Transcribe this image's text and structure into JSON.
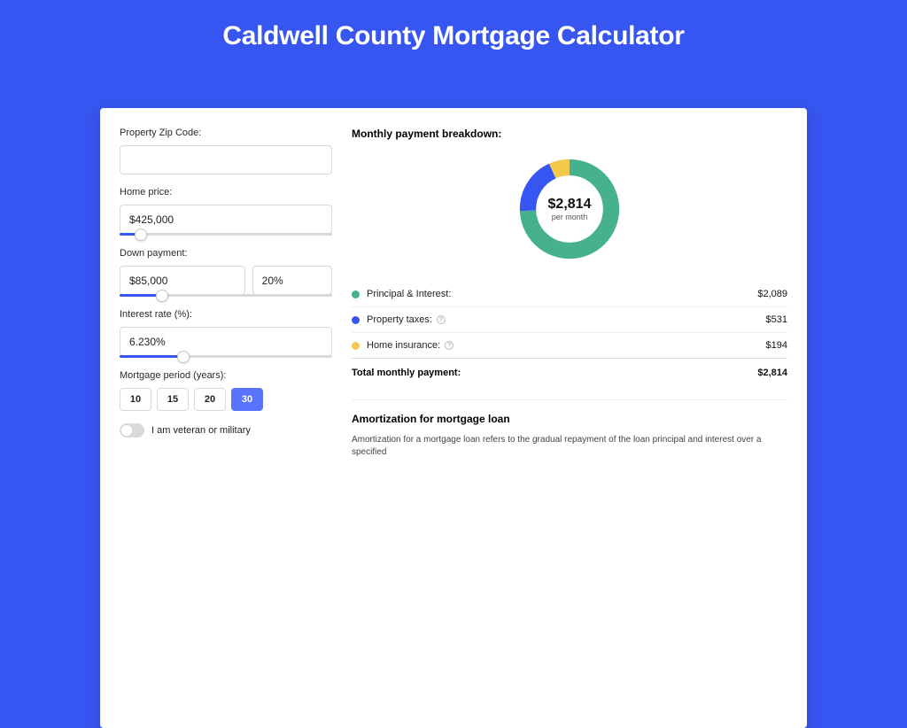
{
  "page": {
    "title": "Caldwell County Mortgage Calculator"
  },
  "inputs": {
    "zip_label": "Property Zip Code:",
    "zip_value": "",
    "home_price_label": "Home price:",
    "home_price_value": "$425,000",
    "home_price_pct": 10,
    "down_label": "Down payment:",
    "down_value": "$85,000",
    "down_pct_value": "20%",
    "down_slider_pct": 20,
    "rate_label": "Interest rate (%):",
    "rate_value": "6.230%",
    "rate_slider_pct": 30,
    "period_label": "Mortgage period (years):",
    "period_options": [
      "10",
      "15",
      "20",
      "30"
    ],
    "period_selected": "30",
    "veteran_label": "I am veteran or military",
    "veteran_on": false
  },
  "breakdown": {
    "title": "Monthly payment breakdown:",
    "donut_value": "$2,814",
    "donut_sub": "per month",
    "items": [
      {
        "label": "Principal & Interest:",
        "value": "$2,089",
        "color": "#45b18e",
        "num": 2089,
        "info": false
      },
      {
        "label": "Property taxes:",
        "value": "$531",
        "color": "#3755f0",
        "num": 531,
        "info": true
      },
      {
        "label": "Home insurance:",
        "value": "$194",
        "color": "#f3c84b",
        "num": 194,
        "info": true
      }
    ],
    "total_label": "Total monthly payment:",
    "total_value": "$2,814"
  },
  "amortization": {
    "title": "Amortization for mortgage loan",
    "text": "Amortization for a mortgage loan refers to the gradual repayment of the loan principal and interest over a specified"
  },
  "chart_data": {
    "type": "pie",
    "title": "Monthly payment breakdown",
    "series": [
      {
        "name": "Principal & Interest",
        "value": 2089,
        "color": "#45b18e"
      },
      {
        "name": "Property taxes",
        "value": 531,
        "color": "#3755f0"
      },
      {
        "name": "Home insurance",
        "value": 194,
        "color": "#f3c84b"
      }
    ],
    "total": 2814,
    "center_label": "$2,814 per month"
  }
}
